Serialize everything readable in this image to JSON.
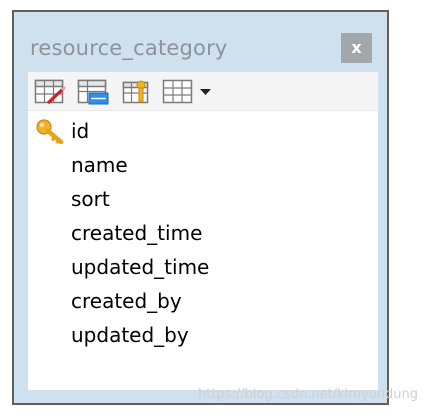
{
  "window": {
    "title": "resource_category",
    "close_label": "x"
  },
  "toolbar": {
    "tools": [
      "design-table-icon",
      "view-form-icon",
      "fields-detail-icon",
      "table-grid-icon"
    ],
    "dropdown_icon": "triangle-down-icon"
  },
  "fields": [
    {
      "name": "id",
      "primary_key": true
    },
    {
      "name": "name",
      "primary_key": false
    },
    {
      "name": "sort",
      "primary_key": false
    },
    {
      "name": "created_time",
      "primary_key": false
    },
    {
      "name": "updated_time",
      "primary_key": false
    },
    {
      "name": "created_by",
      "primary_key": false
    },
    {
      "name": "updated_by",
      "primary_key": false
    }
  ],
  "watermark": "https://blog.csdn.net/kimyundung",
  "colors": {
    "window_bg": "#cfe0ef",
    "title_text": "#8c939a",
    "close_bg": "#a2a7ac",
    "key_icon": "#e8a317"
  }
}
